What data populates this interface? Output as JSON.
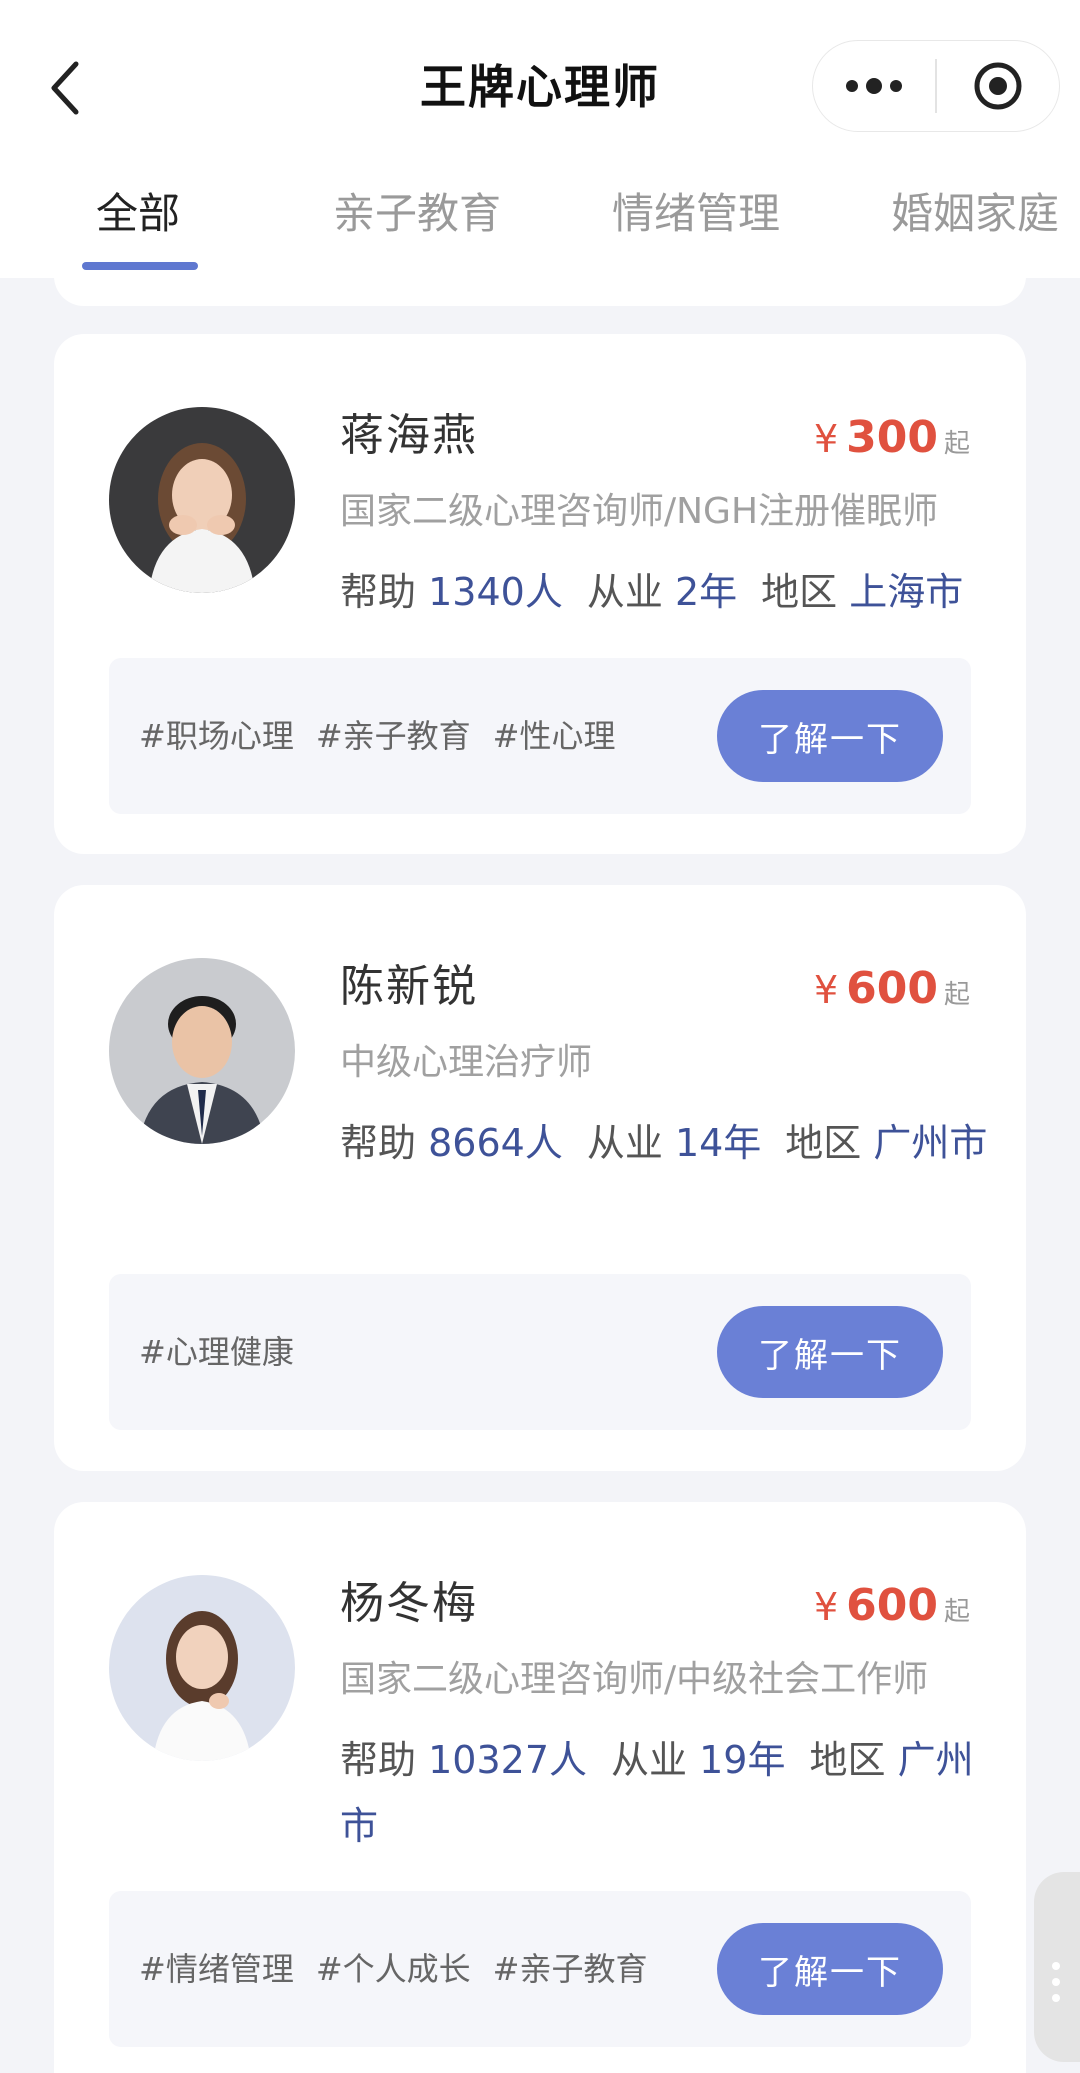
{
  "header": {
    "title": "王牌心理师",
    "back_icon": "chevron-left-icon",
    "more_icon": "more-dots-icon",
    "close_icon": "target-circle-icon"
  },
  "tabs": [
    {
      "label": "全部",
      "active": true
    },
    {
      "label": "亲子教育",
      "active": false
    },
    {
      "label": "情绪管理",
      "active": false
    },
    {
      "label": "婚姻家庭",
      "active": false
    }
  ],
  "accent_color": "#6a80d6",
  "price_color": "#e0513f",
  "therapists": [
    {
      "name": "蒋海燕",
      "currency": "¥",
      "price": "300",
      "price_suffix": "起",
      "credentials": "国家二级心理咨询师/NGH注册催眠师",
      "help_label": "帮助",
      "help_value": "1340人",
      "exp_label": "从业",
      "exp_value": "2年",
      "region_label": "地区",
      "region_value": "上海市",
      "tags": [
        "#职场心理",
        "#亲子教育",
        "#性心理"
      ],
      "button": "了解一下"
    },
    {
      "name": "陈新锐",
      "currency": "¥",
      "price": "600",
      "price_suffix": "起",
      "credentials": "中级心理治疗师",
      "help_label": "帮助",
      "help_value": "8664人",
      "exp_label": "从业",
      "exp_value": "14年",
      "region_label": "地区",
      "region_value": "广州市",
      "tags": [
        "#心理健康"
      ],
      "button": "了解一下"
    },
    {
      "name": "杨冬梅",
      "currency": "¥",
      "price": "600",
      "price_suffix": "起",
      "credentials": "国家二级心理咨询师/中级社会工作师",
      "help_label": "帮助",
      "help_value": "10327人",
      "exp_label": "从业",
      "exp_value": "19年",
      "region_label": "地区",
      "region_value": "广州市",
      "tags": [
        "#情绪管理",
        "#个人成长",
        "#亲子教育"
      ],
      "button": "了解一下"
    }
  ]
}
